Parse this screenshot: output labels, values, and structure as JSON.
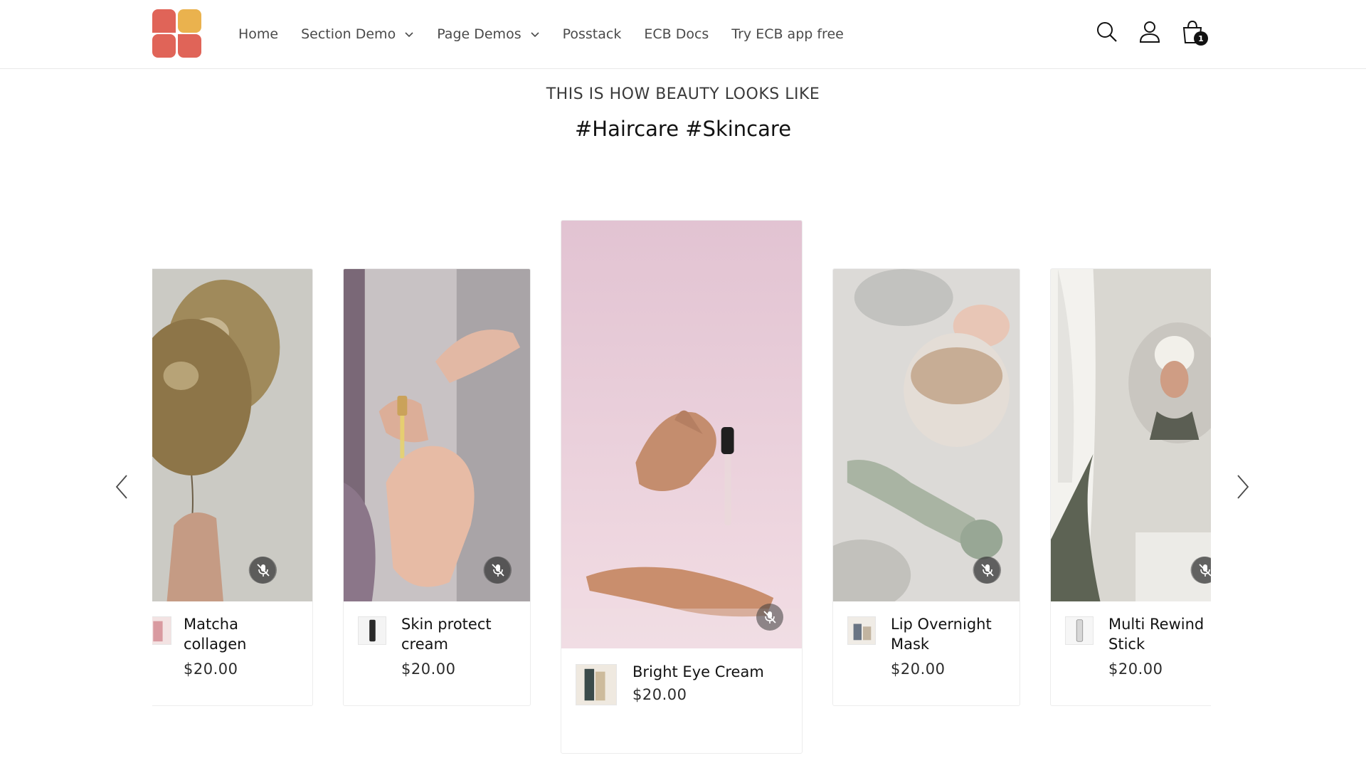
{
  "header": {
    "nav": [
      {
        "label": "Home"
      },
      {
        "label": "Section Demo"
      },
      {
        "label": "Page Demos"
      },
      {
        "label": "Posstack"
      },
      {
        "label": "ECB Docs"
      },
      {
        "label": "Try ECB app free"
      }
    ],
    "icons": [
      "search-icon",
      "account-icon",
      "cart-icon"
    ],
    "cart_count": "1"
  },
  "section": {
    "eyebrow": "THIS IS HOW BEAUTY LOOKS LIKE",
    "title": "#Haircare #Skincare"
  },
  "products": [
    {
      "name": "Matcha collagen",
      "price": "$20.00"
    },
    {
      "name": "Skin protect cream",
      "price": "$20.00"
    },
    {
      "name": "Bright Eye Cream",
      "price": "$20.00"
    },
    {
      "name": "Lip Overnight Mask",
      "price": "$20.00"
    },
    {
      "name": "Multi Rewind Stick",
      "price": "$20.00"
    }
  ],
  "colors": {
    "logo_red": "#e06458",
    "logo_yellow": "#eab24e",
    "text": "#121212",
    "muted_text": "#4a4a4a"
  }
}
